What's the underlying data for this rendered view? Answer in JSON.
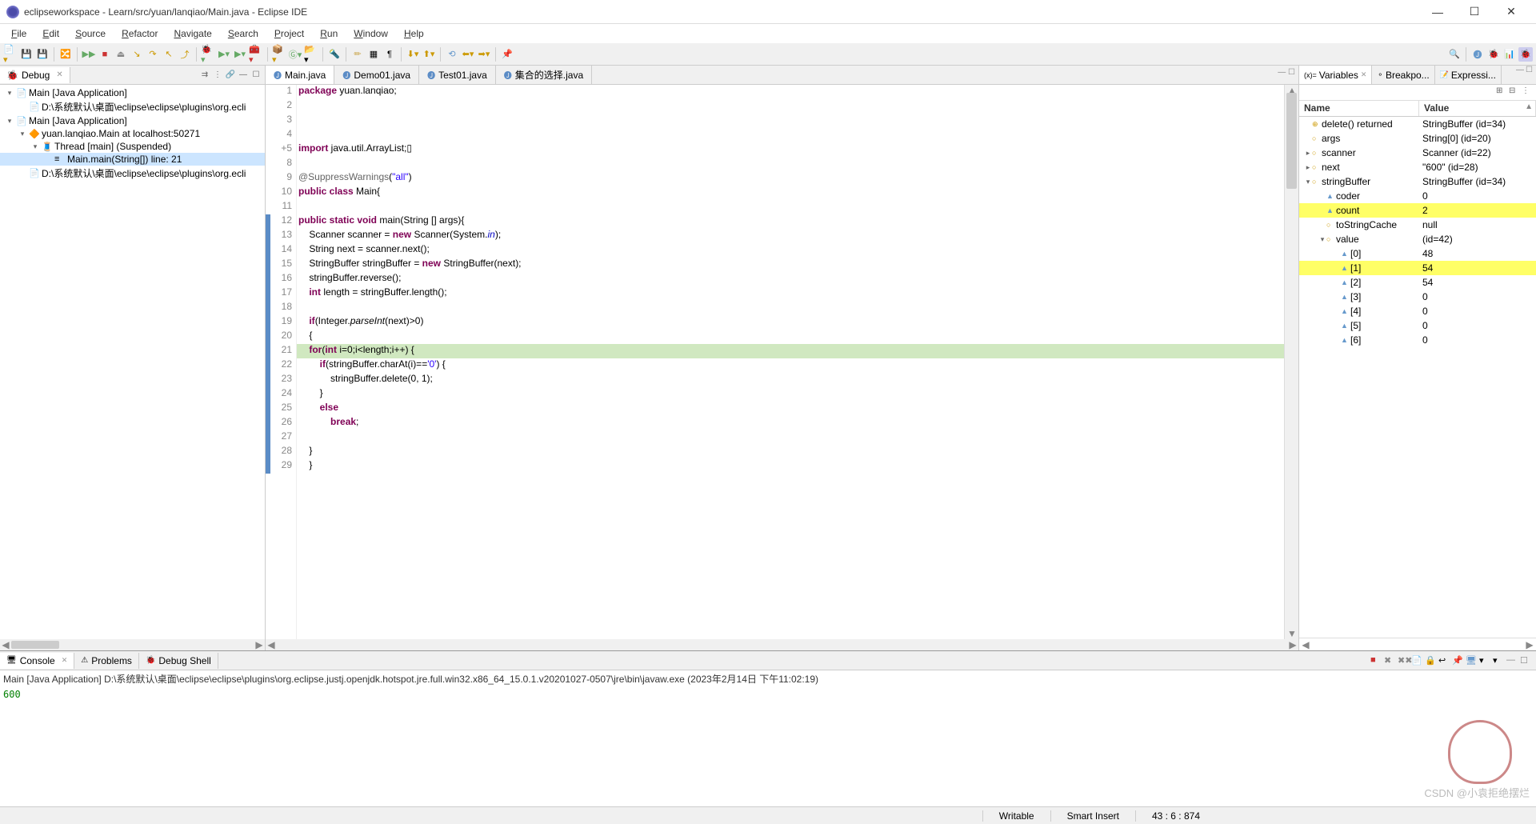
{
  "window": {
    "title": "eclipseworkspace - Learn/src/yuan/lanqiao/Main.java - Eclipse IDE"
  },
  "menu": [
    "File",
    "Edit",
    "Source",
    "Refactor",
    "Navigate",
    "Search",
    "Project",
    "Run",
    "Window",
    "Help"
  ],
  "debug_panel": {
    "title": "Debug",
    "tree": [
      {
        "indent": 0,
        "twist": "▾",
        "icon": "📄",
        "label": "Main [Java Application]"
      },
      {
        "indent": 1,
        "twist": "",
        "icon": "📄",
        "label": "D:\\系统默认\\桌面\\eclipse\\eclipse\\plugins\\org.ecli"
      },
      {
        "indent": 0,
        "twist": "▾",
        "icon": "📄",
        "label": "Main [Java Application]"
      },
      {
        "indent": 1,
        "twist": "▾",
        "icon": "🔶",
        "label": "yuan.lanqiao.Main at localhost:50271"
      },
      {
        "indent": 2,
        "twist": "▾",
        "icon": "🧵",
        "label": "Thread [main] (Suspended)"
      },
      {
        "indent": 3,
        "twist": "",
        "icon": "≡",
        "label": "Main.main(String[]) line: 21",
        "selected": true
      },
      {
        "indent": 1,
        "twist": "",
        "icon": "📄",
        "label": "D:\\系统默认\\桌面\\eclipse\\eclipse\\plugins\\org.ecli"
      }
    ]
  },
  "editor": {
    "tabs": [
      {
        "label": "Main.java",
        "active": true
      },
      {
        "label": "Demo01.java"
      },
      {
        "label": "Test01.java"
      },
      {
        "label": "集合的选择.java"
      }
    ],
    "lines": [
      {
        "n": 1,
        "html": "<span class='kw'>package</span> yuan.lanqiao;"
      },
      {
        "n": 2,
        "html": ""
      },
      {
        "n": 3,
        "html": ""
      },
      {
        "n": 4,
        "html": ""
      },
      {
        "n": 5,
        "marker": "+",
        "html": "<span class='kw'>import</span> java.util.ArrayList;▯"
      },
      {
        "n": 8,
        "html": ""
      },
      {
        "n": 9,
        "html": "<span class='ann'>@SuppressWarnings</span>(<span class='str'>\"all\"</span>)"
      },
      {
        "n": 10,
        "html": "<span class='kw'>public class</span> Main{"
      },
      {
        "n": 11,
        "html": ""
      },
      {
        "n": 12,
        "ruler": true,
        "html": "<span class='kw'>public static void</span> main(String [] args){"
      },
      {
        "n": 13,
        "ruler": true,
        "html": "    Scanner <span>scanner</span> = <span class='kw'>new</span> Scanner(System.<span class='fld'>in</span>);"
      },
      {
        "n": 14,
        "ruler": true,
        "html": "    String <span>next</span> = <span>scanner</span>.next();"
      },
      {
        "n": 15,
        "ruler": true,
        "html": "    StringBuffer <span>stringBuffer</span> = <span class='kw'>new</span> StringBuffer(<span>next</span>);"
      },
      {
        "n": 16,
        "ruler": true,
        "html": "    <span>stringBuffer</span>.reverse();"
      },
      {
        "n": 17,
        "ruler": true,
        "html": "    <span class='kw'>int</span> <span>length</span> = <span>stringBuffer</span>.length();"
      },
      {
        "n": 18,
        "ruler": true,
        "html": ""
      },
      {
        "n": 19,
        "ruler": true,
        "html": "    <span class='kw'>if</span>(Integer.<span style='font-style:italic'>parseInt</span>(<span>next</span>)&gt;0)"
      },
      {
        "n": 20,
        "ruler": true,
        "html": "    {"
      },
      {
        "n": 21,
        "ruler": true,
        "hl": true,
        "html": "    <span class='kw'>for</span>(<span class='kw'>int</span> <span>i</span>=0;<span>i</span>&lt;<span>length</span>;<span>i</span>++) {"
      },
      {
        "n": 22,
        "ruler": true,
        "html": "        <span class='kw'>if</span>(<span>stringBuffer</span>.charAt(<span>i</span>)==<span class='str'>'0'</span>) {"
      },
      {
        "n": 23,
        "ruler": true,
        "html": "            <span>stringBuffer</span>.delete(0, 1);"
      },
      {
        "n": 24,
        "ruler": true,
        "html": "        }"
      },
      {
        "n": 25,
        "ruler": true,
        "html": "        <span class='kw'>else</span>"
      },
      {
        "n": 26,
        "ruler": true,
        "html": "            <span class='kw'>break</span>;"
      },
      {
        "n": 27,
        "ruler": true,
        "html": ""
      },
      {
        "n": 28,
        "ruler": true,
        "html": "    }"
      },
      {
        "n": 29,
        "ruler": true,
        "html": "    }"
      }
    ]
  },
  "variables": {
    "tabs": [
      {
        "label": "Variables",
        "active": true
      },
      {
        "label": "Breakpo..."
      },
      {
        "label": "Expressi..."
      }
    ],
    "head": {
      "name": "Name",
      "value": "Value"
    },
    "rows": [
      {
        "ind": 0,
        "tw": "",
        "ic": "⊕",
        "name": "delete() returned",
        "val": "StringBuffer  (id=34)"
      },
      {
        "ind": 0,
        "tw": "",
        "ic": "○",
        "name": "args",
        "val": "String[0]  (id=20)"
      },
      {
        "ind": 0,
        "tw": "▸",
        "ic": "○",
        "name": "scanner",
        "val": "Scanner  (id=22)"
      },
      {
        "ind": 0,
        "tw": "▸",
        "ic": "○",
        "name": "next",
        "val": "\"600\" (id=28)"
      },
      {
        "ind": 0,
        "tw": "▾",
        "ic": "○",
        "name": "stringBuffer",
        "val": "StringBuffer  (id=34)"
      },
      {
        "ind": 1,
        "tw": "",
        "ic": "▲",
        "name": "coder",
        "val": "0"
      },
      {
        "ind": 1,
        "tw": "",
        "ic": "▲",
        "name": "count",
        "val": "2",
        "hl": true
      },
      {
        "ind": 1,
        "tw": "",
        "ic": "○",
        "name": "toStringCache",
        "val": "null"
      },
      {
        "ind": 1,
        "tw": "▾",
        "ic": "○",
        "name": "value",
        "val": "(id=42)"
      },
      {
        "ind": 2,
        "tw": "",
        "ic": "▲",
        "name": "[0]",
        "val": "48"
      },
      {
        "ind": 2,
        "tw": "",
        "ic": "▲",
        "name": "[1]",
        "val": "54",
        "hl": true
      },
      {
        "ind": 2,
        "tw": "",
        "ic": "▲",
        "name": "[2]",
        "val": "54"
      },
      {
        "ind": 2,
        "tw": "",
        "ic": "▲",
        "name": "[3]",
        "val": "0"
      },
      {
        "ind": 2,
        "tw": "",
        "ic": "▲",
        "name": "[4]",
        "val": "0"
      },
      {
        "ind": 2,
        "tw": "",
        "ic": "▲",
        "name": "[5]",
        "val": "0"
      },
      {
        "ind": 2,
        "tw": "",
        "ic": "▲",
        "name": "[6]",
        "val": "0"
      }
    ]
  },
  "console": {
    "tabs": [
      {
        "label": "Console",
        "active": true
      },
      {
        "label": "Problems"
      },
      {
        "label": "Debug Shell"
      }
    ],
    "info": "Main [Java Application] D:\\系统默认\\桌面\\eclipse\\eclipse\\plugins\\org.eclipse.justj.openjdk.hotspot.jre.full.win32.x86_64_15.0.1.v20201027-0507\\jre\\bin\\javaw.exe  (2023年2月14日 下午11:02:19)",
    "output": "600"
  },
  "statusbar": {
    "writable": "Writable",
    "insert": "Smart Insert",
    "pos": "43 : 6 : 874"
  },
  "watermark": "CSDN @小袁拒绝摆烂"
}
